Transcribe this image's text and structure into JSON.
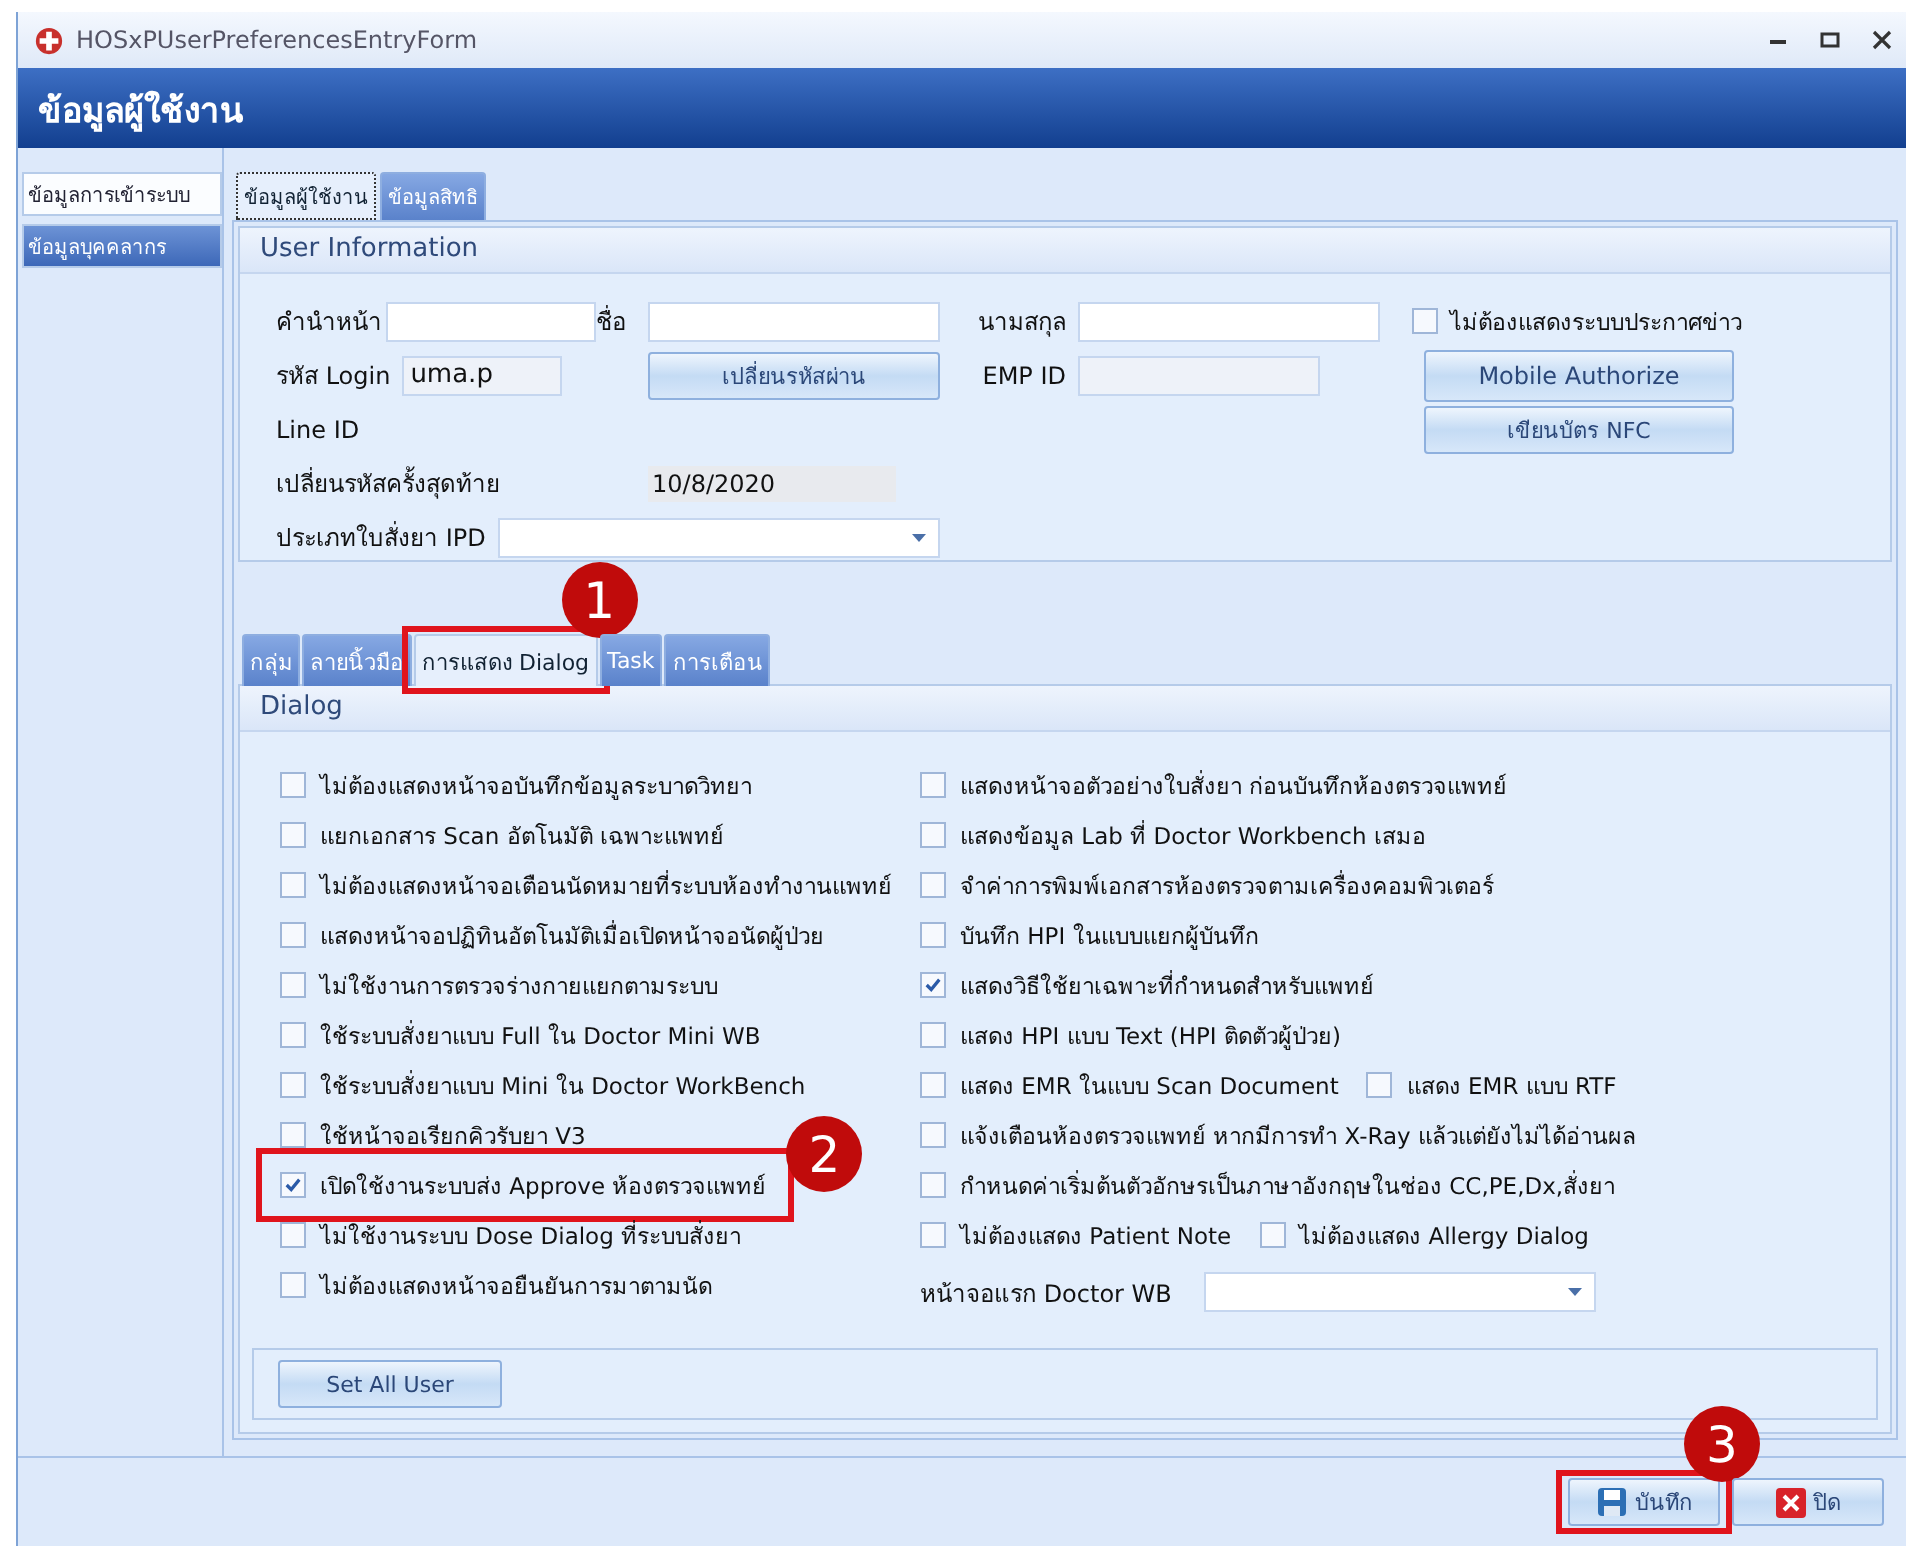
{
  "window": {
    "title": "HOSxPUserPreferencesEntryForm"
  },
  "header": {
    "title": "ข้อมูลผู้ใช้งาน"
  },
  "sidebar": {
    "items": [
      {
        "label": "ข้อมูลการเข้าระบบ",
        "selected": false
      },
      {
        "label": "ข้อมูลบุคคลากร",
        "selected": true
      }
    ]
  },
  "tabs": [
    {
      "label": "ข้อมูลผู้ใช้งาน",
      "selected": true
    },
    {
      "label": "ข้อมูลสิทธิ",
      "selected": false
    }
  ],
  "user_information": {
    "title": "User Information",
    "prefix": {
      "label": "คำนำหน้า"
    },
    "first_name": {
      "label": "ชื่อ"
    },
    "last_name": {
      "label": "นามสกุล"
    },
    "hide_news": {
      "label": "ไม่ต้องแสดงระบบประกาศข่าว",
      "checked": false
    },
    "login": {
      "label": "รหัส Login",
      "value": "uma.p"
    },
    "change_password_button": "เปลี่ยนรหัสผ่าน",
    "emp_id": {
      "label": "EMP ID"
    },
    "mobile_authorize_button": "Mobile Authorize",
    "line_id": {
      "label": "Line ID"
    },
    "nfc_button": "เขียนบัตร NFC",
    "last_password_change": {
      "label": "เปลี่ยนรหัสครั้งสุดท้าย",
      "value": "10/8/2020"
    },
    "ipd_order_type": {
      "label": "ประเภทใบสั่งยา IPD"
    }
  },
  "lower_tabs": [
    {
      "label": "กลุ่ม",
      "selected": false
    },
    {
      "label": "ลายนิ้วมือ",
      "selected": false
    },
    {
      "label": "การแสดง Dialog",
      "selected": true,
      "callout": "1"
    },
    {
      "label": "Task",
      "selected": false
    },
    {
      "label": "การเตือน",
      "selected": false
    }
  ],
  "dialog": {
    "title": "Dialog",
    "left_options": [
      {
        "label": "ไม่ต้องแสดงหน้าจอบันทึกข้อมูลระบาดวิทยา",
        "checked": false
      },
      {
        "label": "แยกเอกสาร Scan อัตโนมัติ เฉพาะแพทย์",
        "checked": false
      },
      {
        "label": "ไม่ต้องแสดงหน้าจอเตือนนัดหมายที่ระบบห้องทำงานแพทย์",
        "checked": false
      },
      {
        "label": "แสดงหน้าจอปฏิทินอัตโนมัติเมื่อเปิดหน้าจอนัดผู้ป่วย",
        "checked": false
      },
      {
        "label": "ไม่ใช้งานการตรวจร่างกายแยกตามระบบ",
        "checked": false
      },
      {
        "label": "ใช้ระบบสั่งยาแบบ Full ใน Doctor Mini WB",
        "checked": false
      },
      {
        "label": "ใช้ระบบสั่งยาแบบ Mini ใน Doctor WorkBench",
        "checked": false
      },
      {
        "label": "ใช้หน้าจอเรียกคิวรับยา V3",
        "checked": false
      },
      {
        "label": "เปิดใช้งานระบบส่ง Approve ห้องตรวจแพทย์",
        "checked": true,
        "callout": "2"
      },
      {
        "label": "ไม่ใช้งานระบบ Dose Dialog ที่ระบบสั่งยา",
        "checked": false
      },
      {
        "label": "ไม่ต้องแสดงหน้าจอยืนยันการมาตามนัด",
        "checked": false
      }
    ],
    "right_options": [
      [
        {
          "label": "แสดงหน้าจอตัวอย่างใบสั่งยา ก่อนบันทึกห้องตรวจแพทย์",
          "checked": false
        }
      ],
      [
        {
          "label": "แสดงข้อมูล Lab ที่ Doctor Workbench เสมอ",
          "checked": false
        }
      ],
      [
        {
          "label": "จำค่าการพิมพ์เอกสารห้องตรวจตามเครื่องคอมพิวเตอร์",
          "checked": false
        }
      ],
      [
        {
          "label": "บันทึก HPI ในแบบแยกผู้บันทึก",
          "checked": false
        }
      ],
      [
        {
          "label": "แสดงวิธีใช้ยาเฉพาะที่กำหนดสำหรับแพทย์",
          "checked": true
        }
      ],
      [
        {
          "label": "แสดง HPI แบบ Text  (HPI ติดตัวผู้ป่วย)",
          "checked": false
        }
      ],
      [
        {
          "label": "แสดง EMR ในแบบ Scan Document",
          "checked": false
        },
        {
          "label": "แสดง EMR แบบ RTF",
          "checked": false
        }
      ],
      [
        {
          "label": "แจ้งเตือนห้องตรวจแพทย์ หากมีการทำ X-Ray แล้วแต่ยังไม่ได้อ่านผล",
          "checked": false
        }
      ],
      [
        {
          "label": "กำหนดค่าเริ่มต้นตัวอักษรเป็นภาษาอังกฤษในช่อง CC,PE,Dx,สั่งยา",
          "checked": false
        }
      ],
      [
        {
          "label": "ไม่ต้องแสดง Patient Note",
          "checked": false
        },
        {
          "label": "ไม่ต้องแสดง Allergy Dialog",
          "checked": false
        }
      ]
    ],
    "doctor_wb_first_screen": {
      "label": "หน้าจอแรก Doctor WB"
    },
    "set_all_user_button": "Set All User"
  },
  "footer_buttons": [
    {
      "kind": "save",
      "label": "บันทึก",
      "callout": "3"
    },
    {
      "kind": "close",
      "label": "ปิด"
    }
  ]
}
